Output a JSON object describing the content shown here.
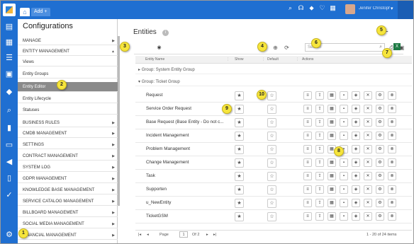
{
  "topbar": {
    "home_icon": "home-icon",
    "add_tab_label": "Add +",
    "username": "Jenifer Christophe Rob..."
  },
  "config_panel": {
    "title": "Configurations",
    "items": [
      {
        "label": "MANAGE",
        "has_arrow": true
      },
      {
        "label": "ENTITY MANAGEMENT",
        "has_arrow": true
      },
      {
        "label": "Views",
        "has_arrow": false
      },
      {
        "label": "Entity Groups",
        "has_arrow": false
      },
      {
        "label": "Entity Editor",
        "has_arrow": false,
        "active": true
      },
      {
        "label": "Entity Lifecycle",
        "has_arrow": false
      },
      {
        "label": "Statuses",
        "has_arrow": false
      },
      {
        "label": "BUSINESS RULES",
        "has_arrow": true
      },
      {
        "label": "CMDB MANAGEMENT",
        "has_arrow": true
      },
      {
        "label": "SETTINGS",
        "has_arrow": true
      },
      {
        "label": "CONTRACT MANAGEMENT",
        "has_arrow": true
      },
      {
        "label": "SYSTEM LOG",
        "has_arrow": true
      },
      {
        "label": "GDPR MANAGEMENT",
        "has_arrow": true
      },
      {
        "label": "KNOWLEDGE BASE MANAGEMENT",
        "has_arrow": true
      },
      {
        "label": "SERVICE CATALOG MANAGEMENT",
        "has_arrow": true
      },
      {
        "label": "BILLBOARD MANAGEMENT",
        "has_arrow": true
      },
      {
        "label": "SOCIAL MEDIA MANAGEMENT",
        "has_arrow": true
      },
      {
        "label": "FINANCIAL MANAGEMENT",
        "has_arrow": true
      }
    ]
  },
  "main": {
    "title": "Entities",
    "search_placeholder": "Search",
    "columns": {
      "entity_name": "Entity Name",
      "show": "Show",
      "default": "Default",
      "actions": "Actions"
    },
    "groups": [
      "Group: System Entity Group",
      "Group: Ticket Group"
    ],
    "rows": [
      {
        "name": "Request"
      },
      {
        "name": "Service Order Request"
      },
      {
        "name": "Base Request (Base Entity - Do not c..."
      },
      {
        "name": "Incident Management"
      },
      {
        "name": "Problem Management"
      },
      {
        "name": "Change Management"
      },
      {
        "name": "Task"
      },
      {
        "name": "Supporten"
      },
      {
        "name": "u_NewEntity"
      },
      {
        "name": "TicketGSM"
      }
    ],
    "pager": {
      "page_label": "Page",
      "page_value": "1",
      "of_label": "Of 2",
      "summary": "1 - 20 of 24 items"
    }
  },
  "callouts": [
    "1",
    "2",
    "3",
    "4",
    "5",
    "6",
    "7",
    "8",
    "9",
    "10"
  ],
  "colors": {
    "brand_blue": "#1f6fd1",
    "callout_yellow": "#f6e53c",
    "active_item": "#8a8a8a"
  }
}
